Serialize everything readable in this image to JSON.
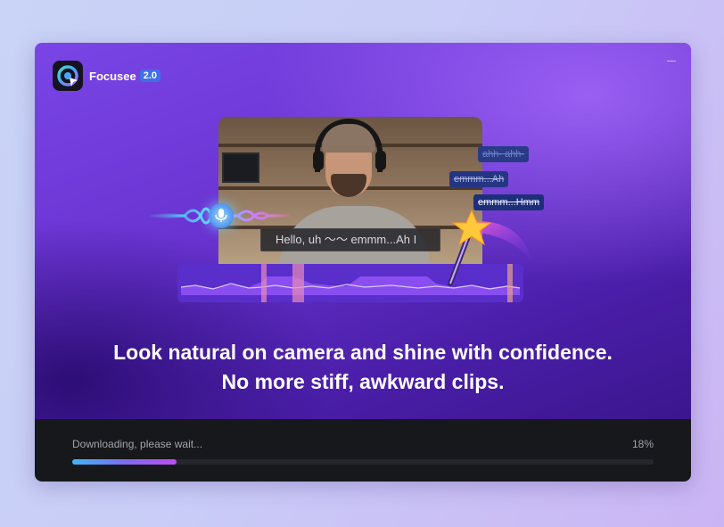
{
  "app": {
    "name": "Focusee",
    "version": "2.0"
  },
  "illustration": {
    "subtitle_text": "Hello, uh 〜〜  emmm...Ah I",
    "filler_tags": [
      "ahh- ahh-",
      "emmm...Ah",
      "emmm...Hmm"
    ]
  },
  "headline": {
    "line1": "Look natural on camera and shine with confidence.",
    "line2": "No more stiff, awkward clips."
  },
  "download": {
    "status": "Downloading, please wait...",
    "percent_label": "18%",
    "progress": 0.18
  },
  "colors": {
    "hero_top": "#7a45e6",
    "hero_bottom": "#3b168e",
    "footer_bg": "#17181c",
    "version_badge": "#3f6fe6",
    "progress_start": "#3fb6f5",
    "progress_end": "#c04df5"
  }
}
